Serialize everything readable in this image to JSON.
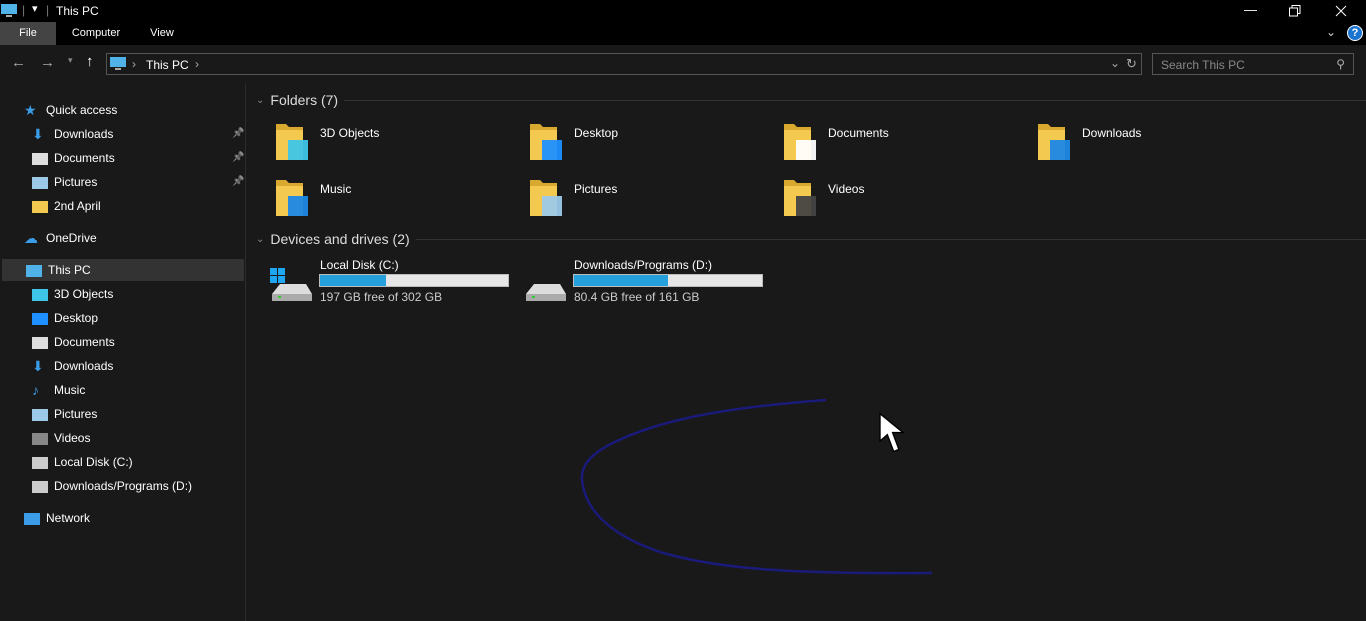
{
  "window": {
    "title": "This PC",
    "minimize_icon": "minimize-icon",
    "restore_icon": "restore-icon",
    "close_icon": "close-icon"
  },
  "ribbon": {
    "tabs": [
      {
        "label": "File"
      },
      {
        "label": "Computer"
      },
      {
        "label": "View"
      }
    ],
    "help": "?"
  },
  "address": {
    "path": "This PC",
    "search_placeholder": "Search This PC"
  },
  "sidebar": {
    "items": [
      {
        "label": "Quick access",
        "icon": "star-icon",
        "level": 0
      },
      {
        "label": "Downloads",
        "icon": "download-icon",
        "level": 1,
        "pinned": true
      },
      {
        "label": "Documents",
        "icon": "document-icon",
        "level": 1,
        "pinned": true
      },
      {
        "label": "Pictures",
        "icon": "pictures-icon",
        "level": 1,
        "pinned": true
      },
      {
        "label": "2nd April",
        "icon": "folder-icon",
        "level": 1
      },
      {
        "label": "OneDrive",
        "icon": "cloud-icon",
        "level": 0
      },
      {
        "label": "This PC",
        "icon": "computer-icon",
        "level": 0,
        "selected": true
      },
      {
        "label": "3D Objects",
        "icon": "cube-icon",
        "level": 1
      },
      {
        "label": "Desktop",
        "icon": "desktop-icon",
        "level": 1
      },
      {
        "label": "Documents",
        "icon": "document-icon",
        "level": 1
      },
      {
        "label": "Downloads",
        "icon": "download-icon",
        "level": 1
      },
      {
        "label": "Music",
        "icon": "music-icon",
        "level": 1
      },
      {
        "label": "Pictures",
        "icon": "pictures-icon",
        "level": 1
      },
      {
        "label": "Videos",
        "icon": "video-icon",
        "level": 1
      },
      {
        "label": "Local Disk (C:)",
        "icon": "drive-icon",
        "level": 1
      },
      {
        "label": "Downloads/Programs (D:)",
        "icon": "drive-icon",
        "level": 1
      },
      {
        "label": "Network",
        "icon": "network-icon",
        "level": 0
      }
    ]
  },
  "main": {
    "folders_header": "Folders (7)",
    "folders": [
      {
        "label": "3D Objects",
        "overlay": "#3ec6e8"
      },
      {
        "label": "Desktop",
        "overlay": "#1e90ff"
      },
      {
        "label": "Documents",
        "overlay": "#ffffff"
      },
      {
        "label": "Downloads",
        "overlay": "#1e88e5"
      },
      {
        "label": "Music",
        "overlay": "#1e88e5"
      },
      {
        "label": "Pictures",
        "overlay": "#9cc9e8"
      },
      {
        "label": "Videos",
        "overlay": "#444444"
      }
    ],
    "drives_header": "Devices and drives (2)",
    "drives": [
      {
        "label": "Local Disk (C:)",
        "free_text": "197 GB free of 302 GB",
        "used_percent": 35,
        "system": true
      },
      {
        "label": "Downloads/Programs (D:)",
        "free_text": "80.4 GB free of 161 GB",
        "used_percent": 50,
        "system": false
      }
    ]
  },
  "colors": {
    "accent": "#26a0da",
    "folder": "#f3c94f",
    "annotation_stroke": "#1a1a7a"
  }
}
